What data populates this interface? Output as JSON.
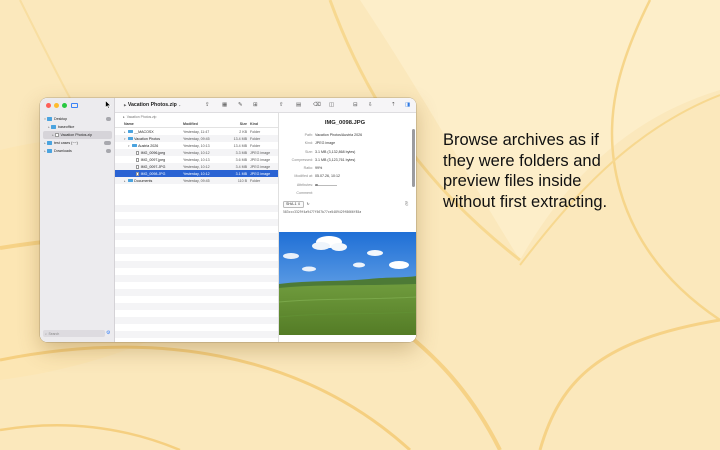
{
  "colors": {
    "accent": "#2a63d3",
    "folder": "#4aa3df",
    "wallpaper": "#fbe7b8"
  },
  "sidebar": {
    "items": [
      {
        "label": "Desktop",
        "icon": "folder-icon",
        "badge": "",
        "expanded": true
      },
      {
        "label": "baseoffice",
        "icon": "folder-icon",
        "badge": "",
        "expanded": false
      },
      {
        "label": "Vacation Photos.zip",
        "icon": "zip-file-icon",
        "badge": "",
        "selected": true
      },
      {
        "label": "test cases (~~)",
        "icon": "folder-icon",
        "badge": ""
      },
      {
        "label": "Downloads",
        "icon": "folder-icon",
        "badge": ""
      }
    ],
    "search_placeholder": "Search"
  },
  "toolbar": {
    "title": "Vacation Photos.zip"
  },
  "list": {
    "path": "Vacation Photos.zip",
    "headers": {
      "name": "Name",
      "modified": "Modified",
      "size": "Size",
      "kind": "Kind"
    },
    "rows": [
      {
        "name": "__MACOSX",
        "modified": "Yesterday, 11:47",
        "size": "2 KB",
        "kind": "Folder",
        "type": "folder",
        "indent": 0,
        "chev": "▸"
      },
      {
        "name": "Vacation Photos",
        "modified": "Yesterday, 09:45",
        "size": "13.4 MB",
        "kind": "Folder",
        "type": "folder",
        "indent": 0,
        "chev": "▾"
      },
      {
        "name": "Austria 2026",
        "modified": "Yesterday, 10:13",
        "size": "13.4 MB",
        "kind": "Folder",
        "type": "folder",
        "indent": 1,
        "chev": "▾"
      },
      {
        "name": "IMG_0096.jpeg",
        "modified": "Yesterday, 10:12",
        "size": "3.3 MB",
        "kind": "JPEG image",
        "type": "file",
        "indent": 2,
        "chev": ""
      },
      {
        "name": "IMG_0097.jpeg",
        "modified": "Yesterday, 10:13",
        "size": "3.6 MB",
        "kind": "JPEG image",
        "type": "file",
        "indent": 2,
        "chev": ""
      },
      {
        "name": "IMG_0097.JPG",
        "modified": "Yesterday, 10:12",
        "size": "3.4 MB",
        "kind": "JPEG image",
        "type": "file",
        "indent": 2,
        "chev": ""
      },
      {
        "name": "IMG_0098.JPG",
        "modified": "Yesterday, 10:12",
        "size": "3.1 MB",
        "kind": "JPEG image",
        "type": "file",
        "indent": 2,
        "chev": "",
        "selected": true
      },
      {
        "name": "Documents",
        "modified": "Yesterday, 09:45",
        "size": "110 B",
        "kind": "Folder",
        "type": "folder",
        "indent": 0,
        "chev": "▸"
      }
    ]
  },
  "preview": {
    "title": "IMG_0098.JPG",
    "props": [
      {
        "key": "Path:",
        "value": "Vacation Photos/Austria 2026"
      },
      {
        "key": "Kind:",
        "value": "JPEG image"
      },
      {
        "key": "Size:",
        "value": "3.1 MB (3,132,868 bytes)"
      },
      {
        "key": "Compressed:",
        "value": "3.1 MB (3,123,761 bytes)"
      },
      {
        "key": "Ratio:",
        "value": "99%"
      },
      {
        "key": "Modified at:",
        "value": "05.07.26, 10:12"
      },
      {
        "key": "Attributes:",
        "value": ""
      },
      {
        "key": "Comment:",
        "value": ""
      }
    ],
    "hash_algorithm": "SHA-1",
    "hash_value": "583ccc3329f4a9477f567b77ce5489429f8666f85a"
  },
  "tagline": [
    "Browse archives as if",
    "they were folders and",
    "preview files inside",
    "without first extracting."
  ]
}
